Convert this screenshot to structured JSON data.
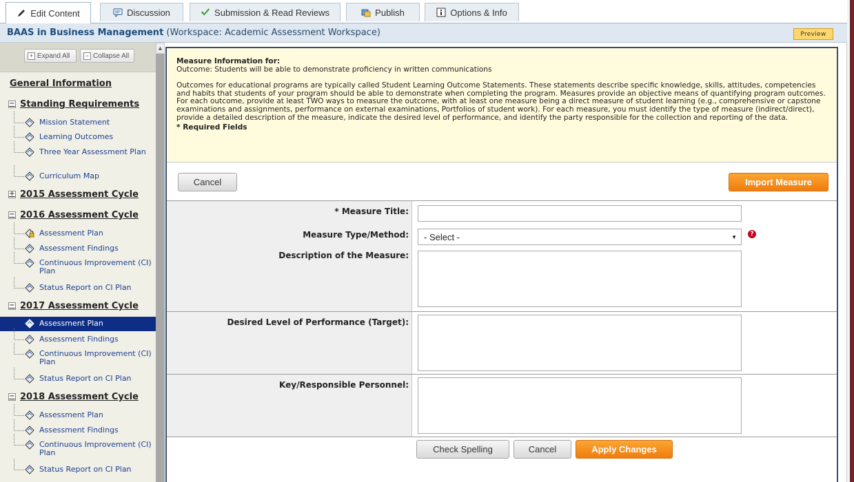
{
  "tabs": [
    {
      "label": "Edit Content",
      "icon": "pencil-icon",
      "active": true
    },
    {
      "label": "Discussion",
      "icon": "chat-icon",
      "active": false
    },
    {
      "label": "Submission & Read Reviews",
      "icon": "checkmark-icon",
      "active": false
    },
    {
      "label": "Publish",
      "icon": "publish-icon",
      "active": false
    },
    {
      "label": "Options & Info",
      "icon": "info-icon",
      "active": false
    }
  ],
  "header": {
    "title": "BAAS in Business Management",
    "workspace": "(Workspace: Academic Assessment Workspace)",
    "preview_label": "Preview"
  },
  "sidebar": {
    "expand_all": "Expand All",
    "collapse_all": "Collapse All",
    "general": "General Information",
    "groups": [
      {
        "title": "Standing Requirements",
        "toggle": "−",
        "items": [
          "Mission Statement",
          "Learning Outcomes",
          "Three Year Assessment Plan",
          "Curriculum Map"
        ]
      },
      {
        "title": "2015 Assessment Cycle",
        "toggle": "+",
        "items": []
      },
      {
        "title": "2016 Assessment Cycle",
        "toggle": "−",
        "items": [
          "Assessment Plan",
          "Assessment Findings",
          "Continuous Improvement (CI) Plan",
          "Status Report on CI Plan"
        ]
      },
      {
        "title": "2017 Assessment Cycle",
        "toggle": "−",
        "items": [
          "Assessment Plan",
          "Assessment Findings",
          "Continuous Improvement (CI) Plan",
          "Status Report on CI Plan"
        ]
      },
      {
        "title": "2018 Assessment Cycle",
        "toggle": "−",
        "items": [
          "Assessment Plan",
          "Assessment Findings",
          "Continuous Improvement (CI) Plan",
          "Status Report on CI Plan"
        ]
      }
    ],
    "selected": "2017 Assessment Cycle / Assessment Plan"
  },
  "notice": {
    "heading": "Measure Information for:",
    "outcome": "Outcome: Students will be able to demonstrate proficiency in written communications",
    "body": "Outcomes for educational programs are typically called Student Learning Outcome Statements. These statements describe specific knowledge, skills, attitudes, competencies and habits that students of your program should be able to demonstrate when completing the program. Measures provide an objective means of quantifying program outcomes. For each outcome, provide at least TWO ways to measure the outcome, with at least one measure being a direct measure of student learning (e.g., comprehensive or capstone examinations and assignments, performance on external examinations, Portfolios of student work). For each measure, you must identify the type of measure (indirect/direct), provide a detailed description of the measure, indicate the desired level of performance, and identify the party responsible for the collection and reporting of the data.",
    "required": "* Required Fields"
  },
  "top_buttons": {
    "cancel": "Cancel",
    "import": "Import Measure"
  },
  "form": {
    "title_label": "* Measure Title:",
    "title_value": "",
    "type_label": "Measure Type/Method:",
    "type_value": "- Select -",
    "help": "?",
    "description_label": "Description of the Measure:",
    "description_value": "",
    "target_label": "Desired Level of Performance (Target):",
    "target_value": "",
    "personnel_label": "Key/Responsible Personnel:",
    "personnel_value": ""
  },
  "bottom_buttons": {
    "spell": "Check Spelling",
    "cancel": "Cancel",
    "apply": "Apply Changes"
  },
  "colors": {
    "accent_orange": "#ef7d10",
    "selection_blue": "#0e2e86",
    "notice_bg": "#fffbdc",
    "title_blue": "#1b4d7e"
  }
}
